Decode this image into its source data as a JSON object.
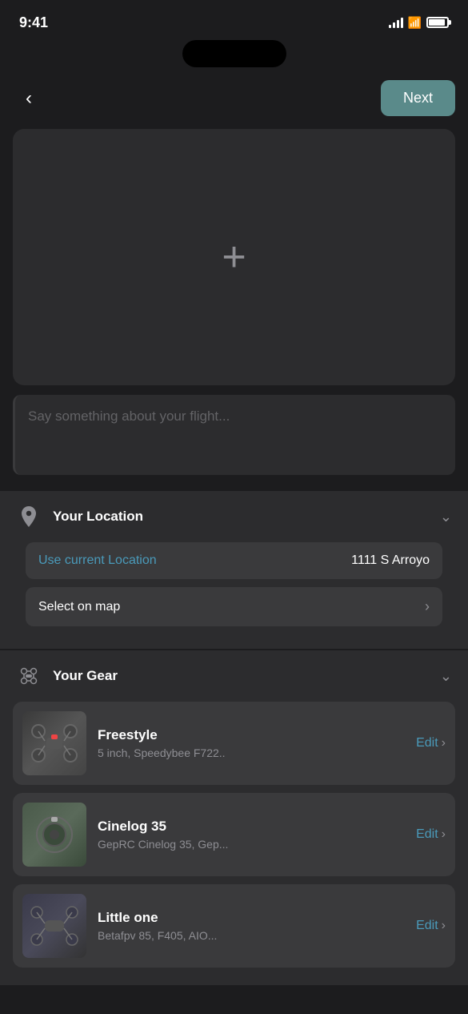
{
  "statusBar": {
    "time": "9:41"
  },
  "nav": {
    "nextLabel": "Next"
  },
  "mediaUpload": {
    "plusSymbol": "+"
  },
  "textInput": {
    "placeholder": "Say something about your flight..."
  },
  "locationSection": {
    "title": "Your Location",
    "useCurrentLocationLabel": "Use current Location",
    "currentLocationValue": "1111 S Arroyo",
    "selectOnMapLabel": "Select on map"
  },
  "gearSection": {
    "title": "Your Gear",
    "items": [
      {
        "name": "Freestyle",
        "details": "5 inch, Speedybee F722..",
        "editLabel": "Edit"
      },
      {
        "name": "Cinelog 35",
        "details": "GepRC Cinelog 35, Gep...",
        "editLabel": "Edit"
      },
      {
        "name": "Little one",
        "details": "Betafpv 85, F405, AIO...",
        "editLabel": "Edit"
      }
    ]
  }
}
